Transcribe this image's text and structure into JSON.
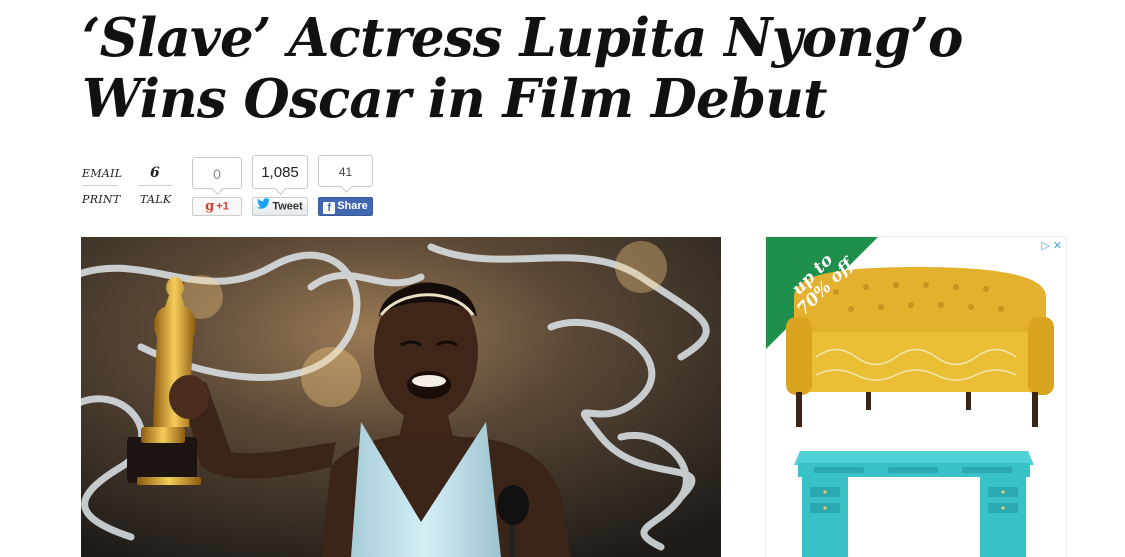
{
  "article": {
    "headline_line1": "‘Slave’ Actress Lupita Nyong’o",
    "headline_line2": "Wins Oscar in Film Debut"
  },
  "meta": {
    "email_label": "EMAIL",
    "print_label": "PRINT",
    "talk_count": "6",
    "talk_label": "TALK"
  },
  "social": {
    "gplus_count": "0",
    "gplus_label": "+1",
    "tweet_count": "1,085",
    "tweet_label": "Tweet",
    "fb_count": "41",
    "fb_label": "Share"
  },
  "ad": {
    "banner_line1": "up to",
    "banner_line2": "70% off",
    "controls": [
      "ad-choices-icon",
      "close-icon"
    ],
    "accent_color": "#1f8f4e"
  },
  "colors": {
    "facebook": "#4267b2",
    "twitter": "#1da1f2",
    "gplus": "#d73d32"
  }
}
